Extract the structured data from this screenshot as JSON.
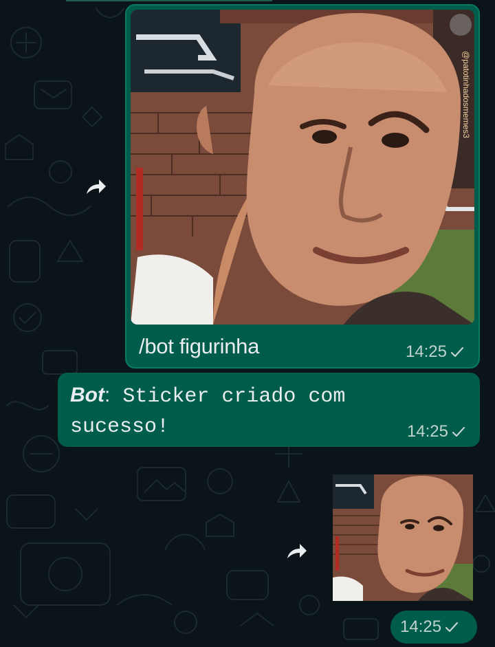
{
  "chat": {
    "messages": [
      {
        "type": "image",
        "caption": "/bot figurinha",
        "time": "14:25",
        "watermark": "@patotinhadosmemes3",
        "status_icon": "single-check-icon"
      },
      {
        "type": "text",
        "sender": "Bot",
        "separator": ":",
        "text": " Sticker criado com sucesso!",
        "time": "14:25",
        "status_icon": "single-check-icon"
      },
      {
        "type": "sticker",
        "time": "14:25",
        "status_icon": "single-check-icon"
      }
    ]
  },
  "icons": {
    "forward": "forward-arrow-icon",
    "check": "single-check-icon"
  },
  "colors": {
    "background": "#0b1418",
    "outgoing_bubble": "#005c4b",
    "bubble_border": "#0a7a63",
    "text": "#e9edef",
    "meta_text": "#c1d3cd"
  }
}
